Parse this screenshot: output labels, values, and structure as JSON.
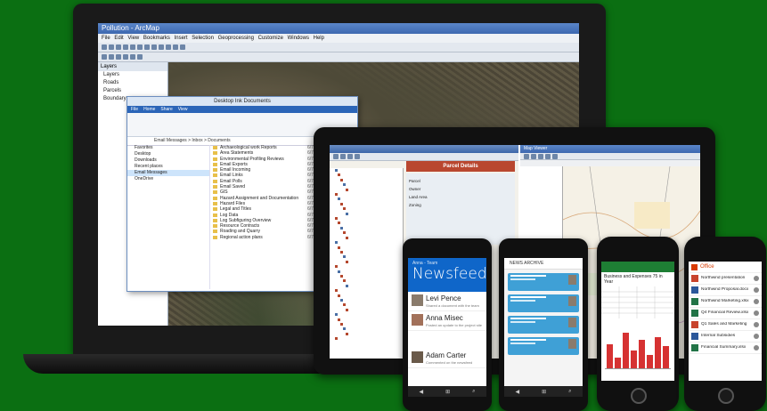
{
  "laptop": {
    "window_title": "Pollution - ArcMap",
    "menu": "File  Edit  View  Bookmarks  Insert  Selection  Geoprocessing  Customize  Windows  Help",
    "toc_header": "Layers",
    "toc_items": [
      "Layers",
      "Roads",
      "Parcels",
      "Boundary"
    ]
  },
  "explorer": {
    "title": "Desktop Ink Documents",
    "tabs": [
      "File",
      "Home",
      "Share",
      "View"
    ],
    "address": "Email Messages > Inbox > Documents",
    "nav": [
      "Favorites",
      "Desktop",
      "Downloads",
      "Recent places",
      "Email Messages",
      "OneDrive"
    ],
    "nav_selected": 4,
    "files": [
      {
        "name": "Archaeological work Reports",
        "date": "6/7/2015"
      },
      {
        "name": "Area Statements",
        "date": "6/7/2015"
      },
      {
        "name": "Environmental Profiling Reviews",
        "date": "6/7/2015"
      },
      {
        "name": "Email Exports",
        "date": "6/7/2015"
      },
      {
        "name": "Email Incoming",
        "date": "6/7/2015"
      },
      {
        "name": "Email Links",
        "date": "6/7/2015"
      },
      {
        "name": "Email Polls",
        "date": "6/7/2015"
      },
      {
        "name": "Email Saved",
        "date": "6/7/2015"
      },
      {
        "name": "GIS",
        "date": "6/7/2015"
      },
      {
        "name": "Hazard Assignment and Documentation",
        "date": "6/7/2015"
      },
      {
        "name": "Hazard Files",
        "date": "6/7/2015"
      },
      {
        "name": "Legal and Titles",
        "date": "6/7/2015"
      },
      {
        "name": "Log Data",
        "date": "6/7/2015"
      },
      {
        "name": "Log Subfiguring Overview",
        "date": "6/7/2015"
      },
      {
        "name": "Resource Contracts",
        "date": "6/7/2015"
      },
      {
        "name": "Roading and Quarry",
        "date": "6/7/2015"
      },
      {
        "name": "Regional action plans",
        "date": "6/7/2015"
      }
    ]
  },
  "tablet": {
    "left_title": "Parcel Details",
    "form_labels": [
      "Parcel",
      "Owner",
      "Land Area",
      "Zoning"
    ],
    "right_title": "Map Viewer"
  },
  "phone1": {
    "header_sub": "Anna - Team",
    "header_title": "Newsfeed",
    "posts": [
      {
        "name": "Levi Pence",
        "text": "Shared a document with the team"
      },
      {
        "name": "Anna Misec",
        "text": "Posted an update to the project site"
      },
      {
        "name": "Adam Carter",
        "text": "Commented on the newsfeed"
      }
    ]
  },
  "phone2": {
    "header": "NEWS ARCHIVE",
    "bubbles": 4
  },
  "phone3": {
    "header": "Business and Expenses 75 in Year",
    "bars": [
      0.55,
      0.25,
      0.8,
      0.4,
      0.65,
      0.3,
      0.7,
      0.5
    ]
  },
  "phone4": {
    "brand": "Office",
    "items": [
      {
        "name": "Northwind presentation",
        "color": "#c8432c"
      },
      {
        "name": "Northwind Proposal.docx",
        "color": "#2b579a"
      },
      {
        "name": "Northwind Marketing.xlsx",
        "color": "#217346"
      },
      {
        "name": "Q4 Financial Review.xlsx",
        "color": "#217346"
      },
      {
        "name": "Q1 Sales and Marketing",
        "color": "#c8432c"
      },
      {
        "name": "Internal Subsidies",
        "color": "#2b579a"
      },
      {
        "name": "Financial Summary.xlsx",
        "color": "#217346"
      }
    ]
  }
}
